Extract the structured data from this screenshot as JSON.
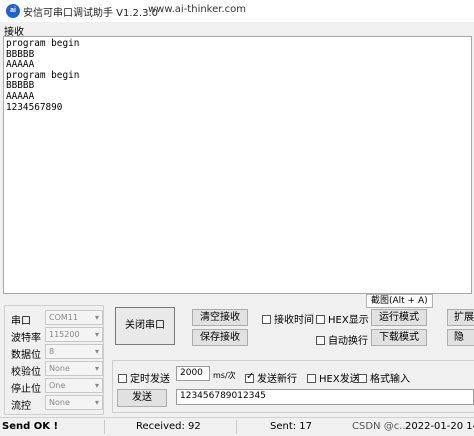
{
  "window": {
    "icon_text": "ai",
    "title": "安信可串口调试助手 V1.2.3.0",
    "url": "www.ai-thinker.com"
  },
  "receive": {
    "label": "接收",
    "lines": [
      "program begin",
      "BBBBB",
      "AAAAA",
      "program begin",
      "BBBBB",
      "AAAAA",
      "1234567890"
    ]
  },
  "tooltip": "截图(Alt + A)",
  "settings": {
    "port": {
      "label": "串口",
      "value": "COM11"
    },
    "baud": {
      "label": "波特率",
      "value": "115200"
    },
    "databits": {
      "label": "数据位",
      "value": "8"
    },
    "parity": {
      "label": "校验位",
      "value": "None"
    },
    "stopbits": {
      "label": "停止位",
      "value": "One"
    },
    "flow": {
      "label": "流控",
      "value": "None"
    }
  },
  "buttons": {
    "close_port": "关闭串口",
    "clear_receive": "清空接收",
    "save_receive": "保存接收",
    "run_mode": "运行模式",
    "download_mode": "下载模式",
    "expand": "扩展",
    "extra": "隐",
    "send": "发送"
  },
  "checkboxes": {
    "recv_time": {
      "label": "接收时间",
      "checked": false
    },
    "hex_display": {
      "label": "HEX显示",
      "checked": false
    },
    "auto_newline": {
      "label": "自动换行",
      "checked": false
    },
    "timed_send": {
      "label": "定时发送",
      "checked": false
    },
    "send_newline": {
      "label": "发送新行",
      "checked": true
    },
    "hex_send": {
      "label": "HEX发送",
      "checked": false
    },
    "format_input": {
      "label": "格式输入",
      "checked": false
    }
  },
  "send": {
    "interval": "2000",
    "interval_unit": "ms/次",
    "text": "123456789012345"
  },
  "status": {
    "state": "Send OK !",
    "received": "Received: 92",
    "sent": "Sent: 17",
    "watermark": "CSDN @c...",
    "datetime": "2022-01-20 14:"
  }
}
